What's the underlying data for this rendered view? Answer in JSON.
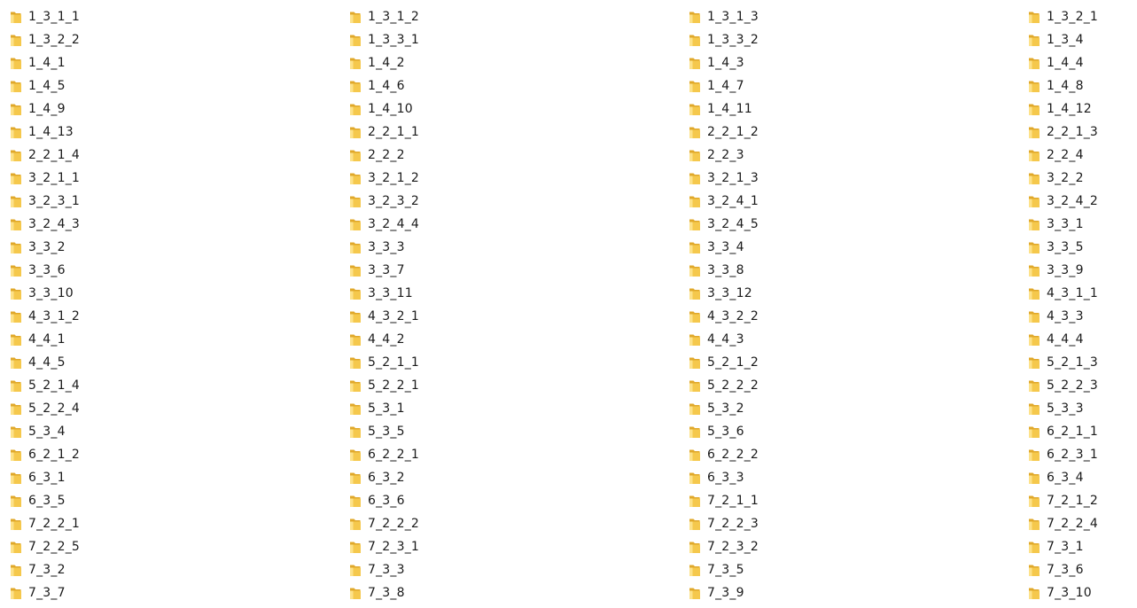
{
  "icon": "folder-icon",
  "colors": {
    "folder_front": "#f5c84c",
    "folder_back": "#e0a82a",
    "folder_light": "#fde28a",
    "text": "#1a1a1a"
  },
  "columns": [
    {
      "items": [
        {
          "name": "1_3_1_1"
        },
        {
          "name": "1_3_2_2"
        },
        {
          "name": "1_4_1"
        },
        {
          "name": "1_4_5"
        },
        {
          "name": "1_4_9"
        },
        {
          "name": "1_4_13"
        },
        {
          "name": "2_2_1_4"
        },
        {
          "name": "3_2_1_1"
        },
        {
          "name": "3_2_3_1"
        },
        {
          "name": "3_2_4_3"
        },
        {
          "name": "3_3_2"
        },
        {
          "name": "3_3_6"
        },
        {
          "name": "3_3_10"
        },
        {
          "name": "4_3_1_2"
        },
        {
          "name": "4_4_1"
        },
        {
          "name": "4_4_5"
        },
        {
          "name": "5_2_1_4"
        },
        {
          "name": "5_2_2_4"
        },
        {
          "name": "5_3_4"
        },
        {
          "name": "6_2_1_2"
        },
        {
          "name": "6_3_1"
        },
        {
          "name": "6_3_5"
        },
        {
          "name": "7_2_2_1"
        },
        {
          "name": "7_2_2_5"
        },
        {
          "name": "7_3_2"
        },
        {
          "name": "7_3_7"
        }
      ]
    },
    {
      "items": [
        {
          "name": "1_3_1_2"
        },
        {
          "name": "1_3_3_1"
        },
        {
          "name": "1_4_2"
        },
        {
          "name": "1_4_6"
        },
        {
          "name": "1_4_10"
        },
        {
          "name": "2_2_1_1"
        },
        {
          "name": "2_2_2"
        },
        {
          "name": "3_2_1_2"
        },
        {
          "name": "3_2_3_2"
        },
        {
          "name": "3_2_4_4"
        },
        {
          "name": "3_3_3"
        },
        {
          "name": "3_3_7"
        },
        {
          "name": "3_3_11"
        },
        {
          "name": "4_3_2_1"
        },
        {
          "name": "4_4_2"
        },
        {
          "name": "5_2_1_1"
        },
        {
          "name": "5_2_2_1"
        },
        {
          "name": "5_3_1"
        },
        {
          "name": "5_3_5"
        },
        {
          "name": "6_2_2_1"
        },
        {
          "name": "6_3_2"
        },
        {
          "name": "6_3_6"
        },
        {
          "name": "7_2_2_2"
        },
        {
          "name": "7_2_3_1"
        },
        {
          "name": "7_3_3"
        },
        {
          "name": "7_3_8"
        }
      ]
    },
    {
      "items": [
        {
          "name": "1_3_1_3"
        },
        {
          "name": "1_3_3_2"
        },
        {
          "name": "1_4_3"
        },
        {
          "name": "1_4_7"
        },
        {
          "name": "1_4_11"
        },
        {
          "name": "2_2_1_2"
        },
        {
          "name": "2_2_3"
        },
        {
          "name": "3_2_1_3"
        },
        {
          "name": "3_2_4_1"
        },
        {
          "name": "3_2_4_5"
        },
        {
          "name": "3_3_4"
        },
        {
          "name": "3_3_8"
        },
        {
          "name": "3_3_12"
        },
        {
          "name": "4_3_2_2"
        },
        {
          "name": "4_4_3"
        },
        {
          "name": "5_2_1_2"
        },
        {
          "name": "5_2_2_2"
        },
        {
          "name": "5_3_2"
        },
        {
          "name": "5_3_6"
        },
        {
          "name": "6_2_2_2"
        },
        {
          "name": "6_3_3"
        },
        {
          "name": "7_2_1_1"
        },
        {
          "name": "7_2_2_3"
        },
        {
          "name": "7_2_3_2"
        },
        {
          "name": "7_3_5"
        },
        {
          "name": "7_3_9"
        }
      ]
    },
    {
      "items": [
        {
          "name": "1_3_2_1"
        },
        {
          "name": "1_3_4"
        },
        {
          "name": "1_4_4"
        },
        {
          "name": "1_4_8"
        },
        {
          "name": "1_4_12"
        },
        {
          "name": "2_2_1_3"
        },
        {
          "name": "2_2_4"
        },
        {
          "name": "3_2_2"
        },
        {
          "name": "3_2_4_2"
        },
        {
          "name": "3_3_1"
        },
        {
          "name": "3_3_5"
        },
        {
          "name": "3_3_9"
        },
        {
          "name": "4_3_1_1"
        },
        {
          "name": "4_3_3"
        },
        {
          "name": "4_4_4"
        },
        {
          "name": "5_2_1_3"
        },
        {
          "name": "5_2_2_3"
        },
        {
          "name": "5_3_3"
        },
        {
          "name": "6_2_1_1"
        },
        {
          "name": "6_2_3_1"
        },
        {
          "name": "6_3_4"
        },
        {
          "name": "7_2_1_2"
        },
        {
          "name": "7_2_2_4"
        },
        {
          "name": "7_3_1"
        },
        {
          "name": "7_3_6"
        },
        {
          "name": "7_3_10"
        }
      ]
    }
  ]
}
